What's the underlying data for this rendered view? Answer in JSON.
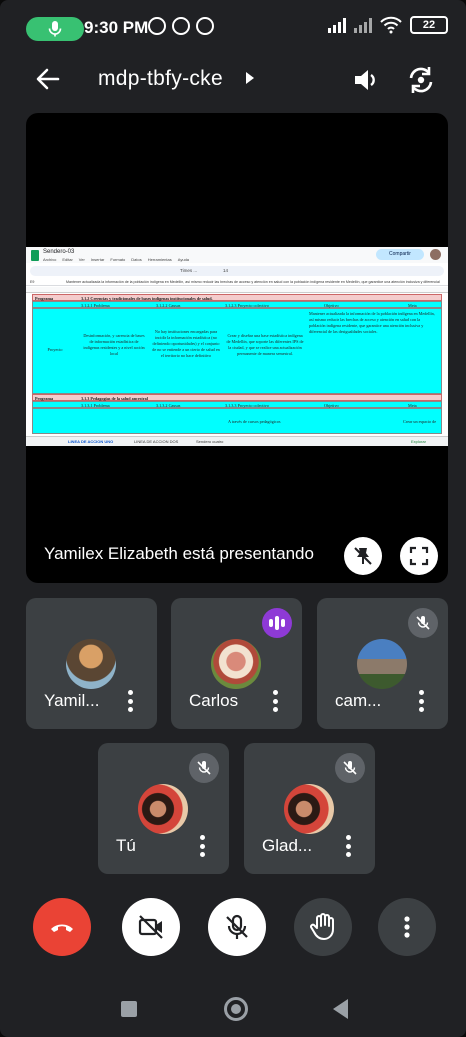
{
  "status_bar": {
    "time": "9:30 PM",
    "battery": "22"
  },
  "meeting": {
    "code": "mdp-tbfy-cke"
  },
  "presentation": {
    "label": "Yamilex Elizabeth está presentando",
    "sheet": {
      "file_name": "Sendero-03",
      "menu": [
        "Archivo",
        "Editar",
        "Ver",
        "Insertar",
        "Formato",
        "Datos",
        "Herramientas",
        "Ayuda"
      ],
      "share_label": "Compartir",
      "cell_ref": "E9",
      "font_name": "Times ...",
      "font_size": "14",
      "formula": "Mantener actualizada la información de la población indígena en Medellín, así mismo reducir las brechas de acceso y atención en salud con la población indígena residente en Medellín, que garantice una atención inclusiva y diferencial",
      "row1_label": "Programa",
      "row1_title": "3.1.2 Creencias y tradicionales de bases indígenas institucionales de salud.",
      "headers": [
        "3.1.2.1 Problema",
        "3.1.2.2 Causas",
        "3.1.2.3 Proyecto colectivo",
        "Objetivo",
        "Meta"
      ],
      "row4_label": "Proyecto",
      "row4_cells": [
        "Desinformación, y carencia de bases de información estadística de indígenas residentes y a nivel acción local",
        "No hay instituciones encargadas para incidir la información estadística (no definiendo oportunidades) y el conjunto de no se entiende a un cierto de salud en el territorio no hace definitivo",
        "Crear y diseñar una base estadística indígena de Medellín, que soporte las diferentes IPS de la ciudad, y que se realice una actualización permanente de manera semestral.",
        "Mantener actualizada la información de la población indígena en Medellín, así mismo reducir las brechas de acceso y atención en salud con la población indígena residente, que garantice una atención inclusiva y diferencial de las desigualdades sociales.",
        ""
      ],
      "row10_label": "Programa",
      "row10_title": "3.1.3 Pedagogías de la salud ancestral",
      "row11_headers": [
        "3.1.3.1 Problema",
        "3.1.3.2 Causas",
        "3.1.3.3 Proyecto colectivo",
        "Objetivo",
        "Meta"
      ],
      "row12_cells": [
        "",
        "",
        "A través de cursos pedagógicos",
        "",
        "Crear un espacio de"
      ],
      "tabs": [
        "LINEA DE ACCION UNO",
        "LINEA DE ACCION DOS",
        "Sendero cuatro"
      ],
      "explore_label": "Explorar"
    }
  },
  "participants": [
    {
      "name": "Yamil...",
      "state": "none"
    },
    {
      "name": "Carlos",
      "state": "speaking"
    },
    {
      "name": "cam...",
      "state": "muted"
    },
    {
      "name": "Tú",
      "state": "muted"
    },
    {
      "name": "Glad...",
      "state": "muted"
    }
  ],
  "colors": {
    "background": "#202124",
    "tile": "#3c4043",
    "end_call": "#ea4335",
    "mic_pill": "#38c172",
    "speaking": "#8e3ad6",
    "sheet_header": "#f4cccc",
    "sheet_cyan": "#00ffff"
  }
}
